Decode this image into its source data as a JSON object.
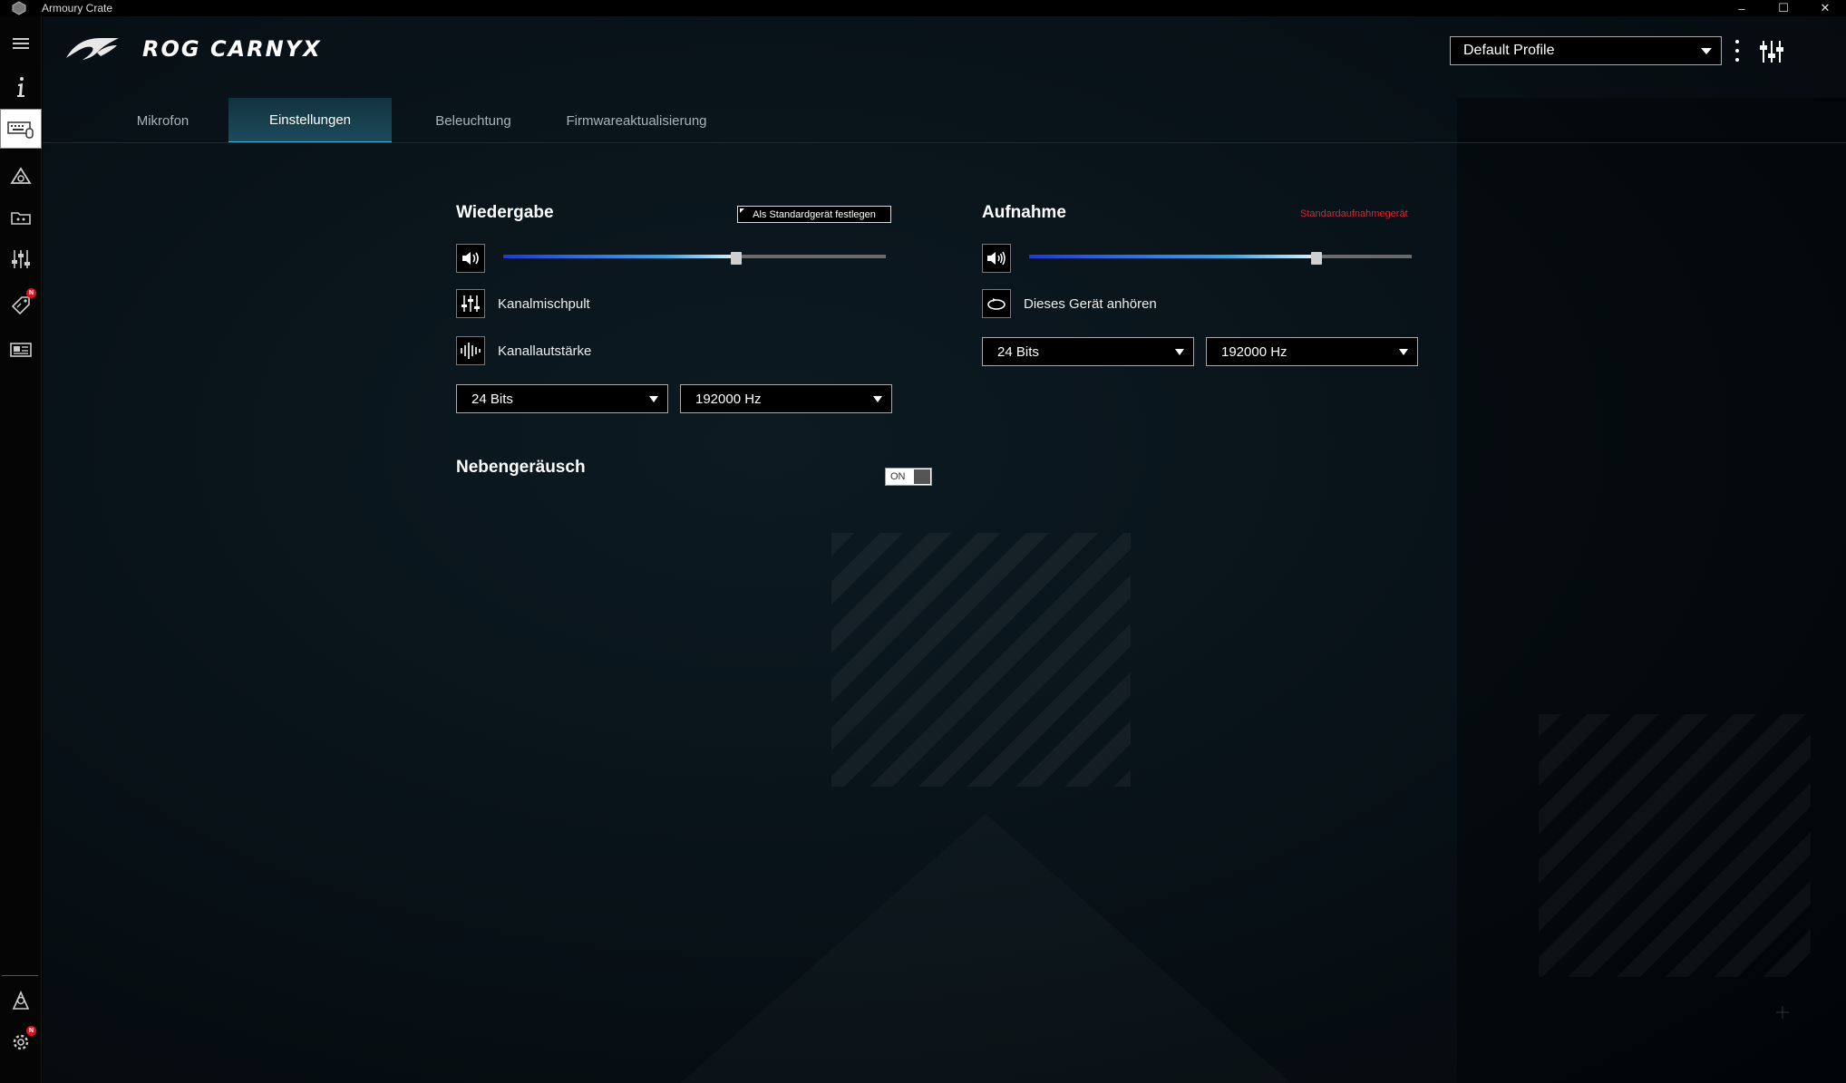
{
  "window": {
    "title": "Armoury Crate",
    "controls": {
      "minimize": "–",
      "maximize": "☐",
      "close": "✕"
    }
  },
  "sidebar": {
    "items": [
      {
        "icon": "menu-icon"
      },
      {
        "icon": "info-icon"
      },
      {
        "icon": "keyboard-mouse-icon",
        "active": true
      },
      {
        "icon": "aura-sync-icon"
      },
      {
        "icon": "game-library-icon"
      },
      {
        "icon": "audio-mixer-icon"
      },
      {
        "icon": "deals-tag-icon",
        "badge": "N"
      },
      {
        "icon": "news-icon"
      }
    ],
    "bottom": [
      {
        "icon": "user-center-icon"
      },
      {
        "icon": "settings-icon",
        "badge": "N"
      }
    ]
  },
  "header": {
    "product_name": "ROG CARNYX",
    "profile": "Default Profile"
  },
  "tabs": [
    {
      "label": "Mikrofon",
      "active": false
    },
    {
      "label": "Einstellungen",
      "active": true
    },
    {
      "label": "Beleuchtung",
      "active": false
    },
    {
      "label": "Firmwareaktualisierung",
      "active": false
    }
  ],
  "playback": {
    "title": "Wiedergabe",
    "set_default_label": "Als Standardgerät festlegen",
    "volume": 0.61,
    "mixer_label": "Kanalmischpult",
    "channel_volume_label": "Kanallautstärke",
    "bit_depth": "24 Bits",
    "sample_rate": "192000 Hz"
  },
  "recording": {
    "title": "Aufnahme",
    "default_notice": "Standardaufnahmegerät",
    "volume": 0.75,
    "listen_label": "Dieses Gerät anhören",
    "bit_depth": "24 Bits",
    "sample_rate": "192000 Hz"
  },
  "sidetone": {
    "title": "Nebengeräusch",
    "state": "ON"
  },
  "colors": {
    "accent": "#3aa7e8",
    "notice_red": "#e0242c",
    "badge_red": "#e0101c"
  }
}
